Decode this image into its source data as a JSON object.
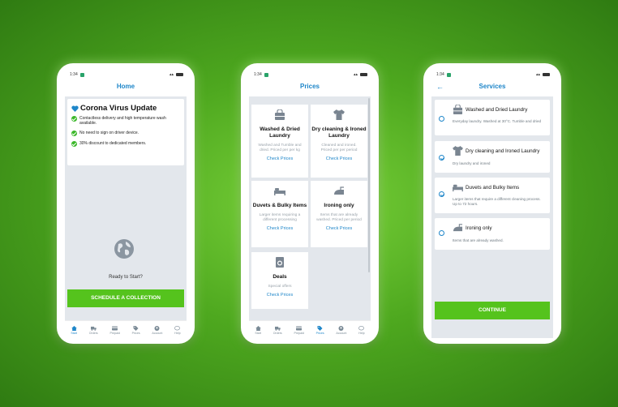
{
  "status": {
    "time": "1:34"
  },
  "phones": [
    {
      "title": "Home",
      "update_card": {
        "title": "Corona Virus Update",
        "items": [
          "Contactless delivery and high temperature wash available.",
          "No need to sign on driver device.",
          "30% discount to dedicated members."
        ]
      },
      "ready_text": "Ready to Start?",
      "cta": "SCHEDULE A COLLECTION",
      "tabs": [
        "Start",
        "Orders",
        "Prepaid",
        "Prices",
        "Account",
        "Help"
      ],
      "active_tab": 0
    },
    {
      "title": "Prices",
      "cards": [
        {
          "title": "Washed & Dried Laundry",
          "desc": "Washed and Tumble and dried. Priced per per kg",
          "link": "Check Prices",
          "icon": "bag-icon"
        },
        {
          "title": "Dry cleaning & Ironed Laundry",
          "desc": "Cleaned and ironed. Priced per per period",
          "link": "Check Prices",
          "icon": "shirt-icon"
        },
        {
          "title": "Duvets & Bulky Items",
          "desc": "Larger items requiring a different processing",
          "link": "Check Prices",
          "icon": "bed-icon"
        },
        {
          "title": "Ironing only",
          "desc": "Items that are already washed. Priced per period",
          "link": "Check Prices",
          "icon": "iron-icon"
        },
        {
          "title": "Deals",
          "desc": "Special offers",
          "link": "Check Prices",
          "icon": "washer-icon"
        }
      ],
      "tabs": [
        "Start",
        "Orders",
        "Prepaid",
        "Prices",
        "Account",
        "Help"
      ],
      "active_tab": 3
    },
    {
      "title": "Services",
      "services": [
        {
          "title": "Washed and Dried Laundry",
          "desc": "Everyday laundry. Washed at 30°C. Tumble and dried",
          "checked": false,
          "icon": "bag-icon"
        },
        {
          "title": "Dry cleaning and Ironed Laundry",
          "desc": "Dry laundry and ironed",
          "checked": true,
          "icon": "shirt-icon"
        },
        {
          "title": "Duvets and Bulky Items",
          "desc": "Larger items that require a different cleaning process. Up to 72 hours.",
          "checked": true,
          "icon": "bed-icon"
        },
        {
          "title": "Ironing only",
          "desc": "Items that are already washed.",
          "checked": false,
          "icon": "iron-icon"
        }
      ],
      "cta": "CONTINUE"
    }
  ],
  "colors": {
    "accent": "#1e86c9",
    "green": "#55c31d",
    "screen_bg": "#e3e7ec"
  }
}
